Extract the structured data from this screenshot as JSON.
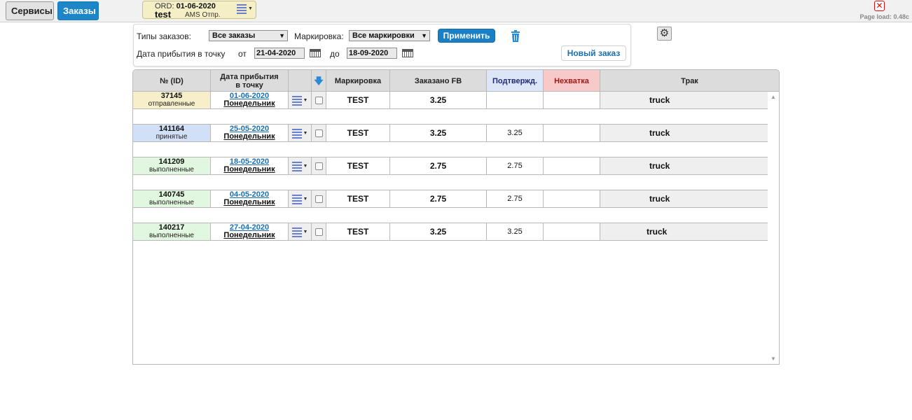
{
  "topbar": {
    "services_label": "Сервисы",
    "orders_label": "Заказы",
    "order_pill": {
      "prefix": "ORD:",
      "date": "01-06-2020",
      "name": "test",
      "sub": "AMS Отпр."
    },
    "page_load": "Page load: 0.48c",
    "close_icon": "close-icon"
  },
  "filter": {
    "order_types_label": "Типы заказов:",
    "order_types_value": "Все заказы",
    "marking_label": "Маркировка:",
    "marking_value": "Все маркировки",
    "apply_label": "Применить",
    "arrival_label": "Дата прибытия в точку",
    "from_label": "от",
    "from_value": "21-04-2020",
    "to_label": "до",
    "to_value": "18-09-2020",
    "new_order_label": "Новый заказ"
  },
  "table": {
    "headers": {
      "id": "№ (ID)",
      "arrival_line1": "Дата прибытия",
      "arrival_line2": "в точку",
      "marking": "Маркировка",
      "ordered": "Заказано FB",
      "confirmed": "Подтвержд.",
      "shortage": "Нехватка",
      "truck": "Трак"
    },
    "rows": [
      {
        "id": "37145",
        "status": "отправленные",
        "status_key": "sent",
        "date": "01-06-2020",
        "weekday": "Понедельник",
        "marking": "TEST",
        "ordered": "3.25",
        "confirmed": "",
        "shortage": "",
        "truck": "truck"
      },
      {
        "id": "141164",
        "status": "принятые",
        "status_key": "accepted",
        "date": "25-05-2020",
        "weekday": "Понедельник",
        "marking": "TEST",
        "ordered": "3.25",
        "confirmed": "3.25",
        "shortage": "",
        "truck": "truck"
      },
      {
        "id": "141209",
        "status": "выполненные",
        "status_key": "done",
        "date": "18-05-2020",
        "weekday": "Понедельник",
        "marking": "TEST",
        "ordered": "2.75",
        "confirmed": "2.75",
        "shortage": "",
        "truck": "truck"
      },
      {
        "id": "140745",
        "status": "выполненные",
        "status_key": "done",
        "date": "04-05-2020",
        "weekday": "Понедельник",
        "marking": "TEST",
        "ordered": "2.75",
        "confirmed": "2.75",
        "shortage": "",
        "truck": "truck"
      },
      {
        "id": "140217",
        "status": "выполненные",
        "status_key": "done",
        "date": "27-04-2020",
        "weekday": "Понедельник",
        "marking": "TEST",
        "ordered": "3.25",
        "confirmed": "3.25",
        "shortage": "",
        "truck": "truck"
      }
    ]
  },
  "colors": {
    "accent": "#1a7fc4",
    "status_sent": "#f6efc9",
    "status_accepted": "#d2e0f7",
    "status_done": "#e2f7df",
    "confirmed_header": "#dde5f8",
    "shortage_header": "#f7c9c9"
  }
}
